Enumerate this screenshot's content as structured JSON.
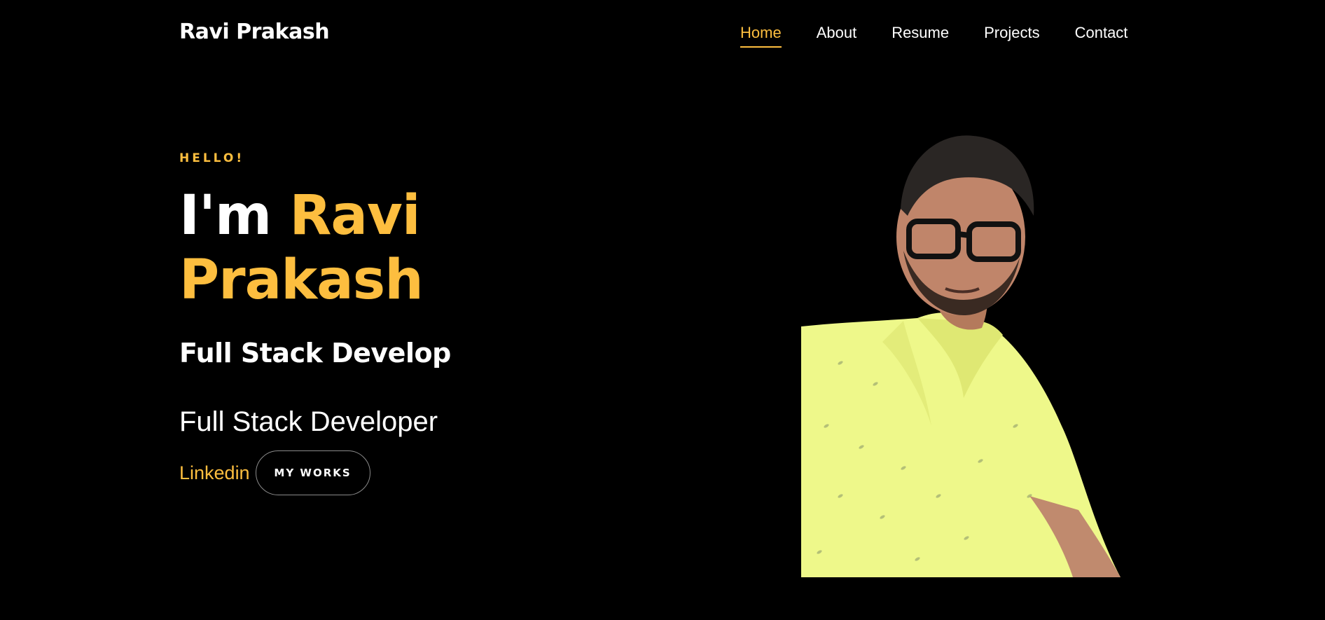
{
  "header": {
    "brand": "Ravi Prakash",
    "nav": [
      {
        "label": "Home",
        "active": true
      },
      {
        "label": "About",
        "active": false
      },
      {
        "label": "Resume",
        "active": false
      },
      {
        "label": "Projects",
        "active": false
      },
      {
        "label": "Contact",
        "active": false
      }
    ]
  },
  "hero": {
    "greeting": "HELLO!",
    "intro": "I'm",
    "first_name": "Ravi",
    "last_name": "Prakash",
    "typing_text": "Full Stack Develop",
    "role": "Full Stack Developer",
    "linkedin_label": "Linkedin",
    "works_button": "MY WORKS"
  },
  "colors": {
    "background": "#000000",
    "accent": "#fdbe3f",
    "text": "#ffffff",
    "shirt": "#eef88a"
  }
}
